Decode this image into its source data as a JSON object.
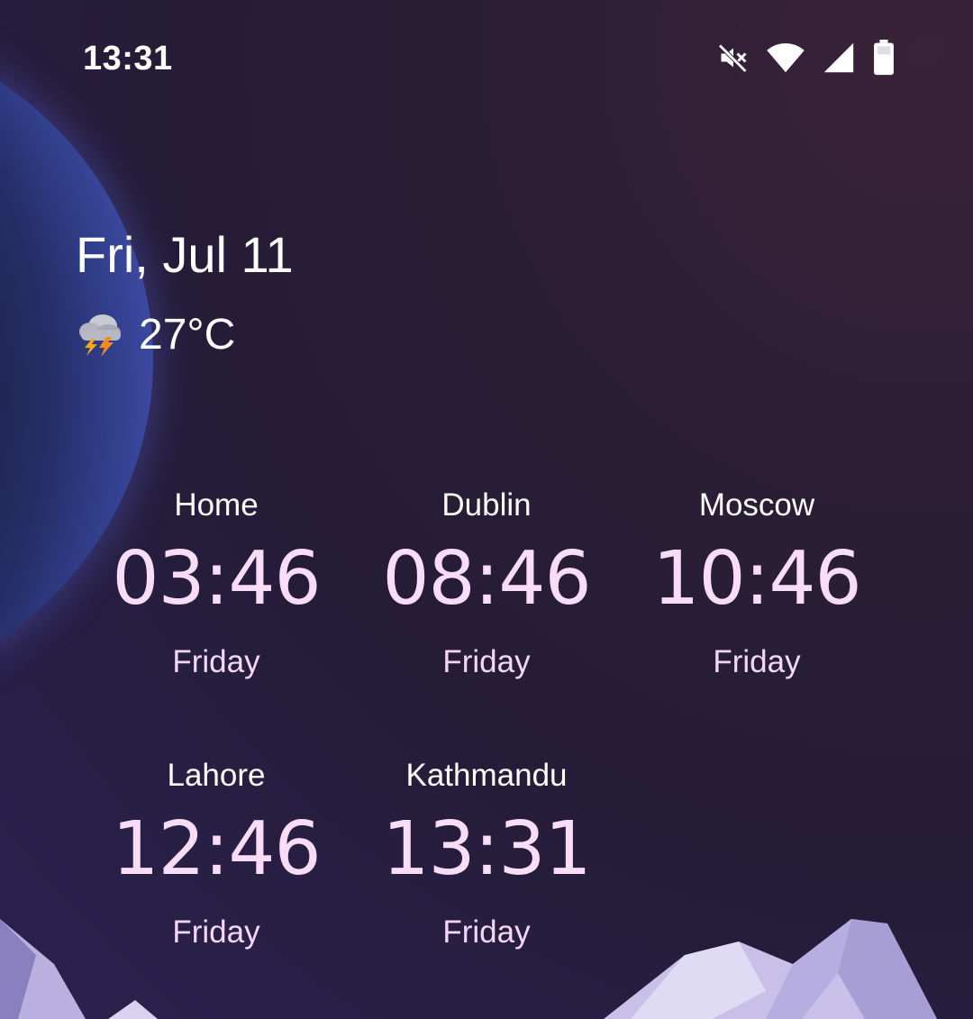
{
  "status_bar": {
    "time": "13:31",
    "icons": [
      "mute-icon",
      "wifi-icon",
      "signal-icon",
      "battery-icon"
    ]
  },
  "date": "Fri, Jul 11",
  "weather": {
    "icon": "thunderstorm-icon",
    "temperature": "27°C"
  },
  "clocks": [
    {
      "city": "Home",
      "time": "03:46",
      "day": "Friday"
    },
    {
      "city": "Dublin",
      "time": "08:46",
      "day": "Friday"
    },
    {
      "city": "Moscow",
      "time": "10:46",
      "day": "Friday"
    },
    {
      "city": "Lahore",
      "time": "12:46",
      "day": "Friday"
    },
    {
      "city": "Kathmandu",
      "time": "13:31",
      "day": "Friday"
    }
  ],
  "colors": {
    "clock_time": "#f8dcf8",
    "background": "#2a1e36",
    "text": "#ffffff"
  }
}
